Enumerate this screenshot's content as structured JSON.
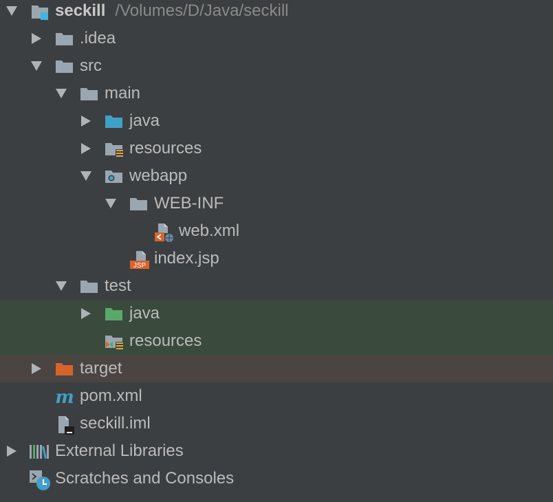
{
  "project": {
    "name": "seckill",
    "path": "/Volumes/D/Java/seckill"
  },
  "nodes": {
    "idea": ".idea",
    "src": "src",
    "main": "main",
    "main_java": "java",
    "main_resources": "resources",
    "webapp": "webapp",
    "webinf": "WEB-INF",
    "webxml": "web.xml",
    "indexjsp": "index.jsp",
    "test": "test",
    "test_java": "java",
    "test_resources": "resources",
    "target": "target",
    "pom": "pom.xml",
    "iml": "seckill.iml",
    "libs": "External Libraries",
    "scratches": "Scratches and Consoles"
  },
  "icon_text": {
    "jsp": "JSP",
    "maven": "m"
  },
  "colors": {
    "background": "#3c3f41",
    "text": "#bbbbbb",
    "path_text": "#8a8a8a",
    "folder": "#9aa7b0",
    "source_folder": "#40a0c8",
    "test_folder": "#59a869",
    "excluded_folder": "#d7632b",
    "test_highlight": "#3a4a3c",
    "excluded_highlight": "#4a4542",
    "module_badge": "#40b6e0"
  }
}
